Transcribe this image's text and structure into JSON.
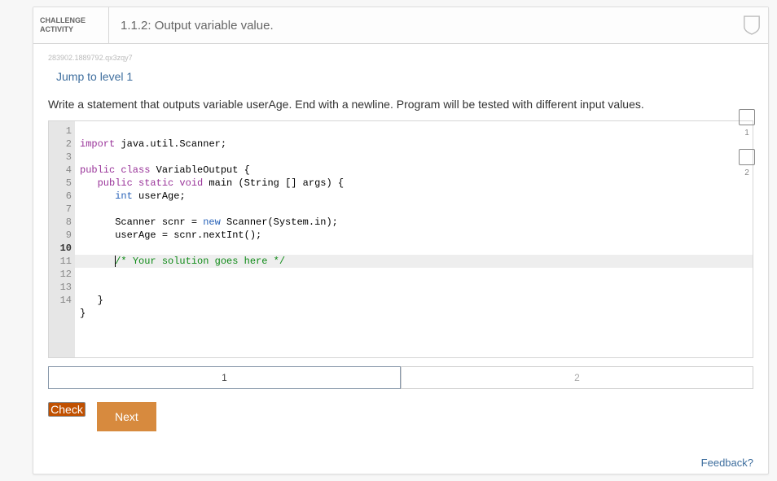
{
  "header": {
    "chip_l1": "CHALLENGE",
    "chip_l2": "ACTIVITY",
    "title": "1.1.2: Output variable value."
  },
  "hash": "283902.1889792.qx3zqy7",
  "jump_link": "Jump to level 1",
  "prompt": "Write a statement that outputs variable userAge. End with a newline. Program will be tested with different input values.",
  "lines": [
    1,
    2,
    3,
    4,
    5,
    6,
    7,
    8,
    9,
    10,
    11,
    12,
    13,
    14
  ],
  "code": {
    "l1_kw": "import",
    "l1_rest": " java.util.Scanner;",
    "l3_kw": "public class",
    "l3_rest": " VariableOutput {",
    "l4_kw1": "public static void",
    "l4_fn": " main ",
    "l4_paren": "(String [] args) {",
    "l5_kw": "int",
    "l5_rest": " userAge;",
    "l7": "      Scanner scnr = ",
    "l7_kw": "new",
    "l7_rest": " Scanner(System.in);",
    "l8": "      userAge = scnr.nextInt();",
    "l10_cmt": "/* Your solution goes here */",
    "l12": "   }",
    "l13": "}"
  },
  "steps": {
    "one": "1",
    "two": "2"
  },
  "buttons": {
    "check": "Check",
    "next": "Next"
  },
  "feedback": "Feedback?",
  "progress": {
    "p1": "1",
    "p2": "2"
  }
}
